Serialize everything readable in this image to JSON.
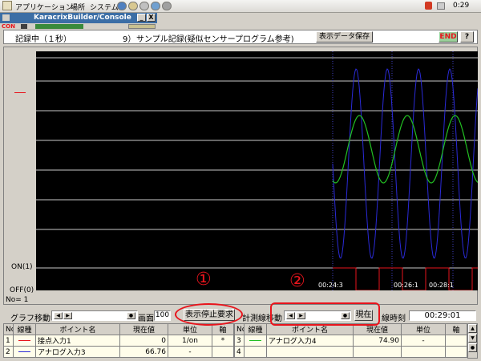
{
  "taskbar": {
    "menu_apps": "アプリケーション",
    "menu_places": "場所",
    "menu_system": "システム",
    "clock": "0:29"
  },
  "window": {
    "title": "KaracrixBuilder/Console",
    "min": "_",
    "close": "X",
    "side_label": "CON"
  },
  "header": {
    "status": "記録中（１秒）",
    "number": "9）",
    "title": "サンプル記録(疑似センサープログラム参考)",
    "save_button": "表示データ保存",
    "end_button": "END",
    "help_button": "?"
  },
  "plot": {
    "y_labels": [
      "ON(1)",
      "OFF(0)",
      "No= 1"
    ],
    "x_ticks": [
      "00:24:3",
      "00:26:1",
      "00:28:1"
    ],
    "legend_dash_color": "#e8141c",
    "colors": {
      "green": "#22c022",
      "blue": "#2a2ad8",
      "red": "#e8141c",
      "grid": "#c8c8c8"
    }
  },
  "controls": {
    "graph_move_label": "グラフ移動",
    "screen_label": "画面",
    "screen_value": "100",
    "stop_button": "表示停止要求",
    "cursor_move_label": "計測線移動",
    "now_button": "現在",
    "cursor_time_label": "線時刻",
    "cursor_time_value": "00:29:01"
  },
  "annotations": {
    "one": "①",
    "two": "②"
  },
  "table_left": {
    "headers": [
      "No",
      "線種",
      "ポイント名",
      "現在値",
      "単位",
      "軸"
    ],
    "rows": [
      {
        "no": "1",
        "name": "接点入力1",
        "value": "0",
        "unit": "1/on",
        "axis": "*",
        "color": "#e8141c"
      },
      {
        "no": "2",
        "name": "アナログ入力3",
        "value": "66.76",
        "unit": "-",
        "axis": "",
        "color": "#2a2ad8"
      }
    ]
  },
  "table_right": {
    "headers": [
      "No",
      "線種",
      "ポイント名",
      "現在値",
      "単位",
      "軸"
    ],
    "rows": [
      {
        "no": "3",
        "name": "アナログ入力4",
        "value": "74.90",
        "unit": "-",
        "axis": "",
        "color": "#22c022"
      },
      {
        "no": "4",
        "name": "",
        "value": "",
        "unit": "",
        "axis": "",
        "color": ""
      }
    ]
  }
}
